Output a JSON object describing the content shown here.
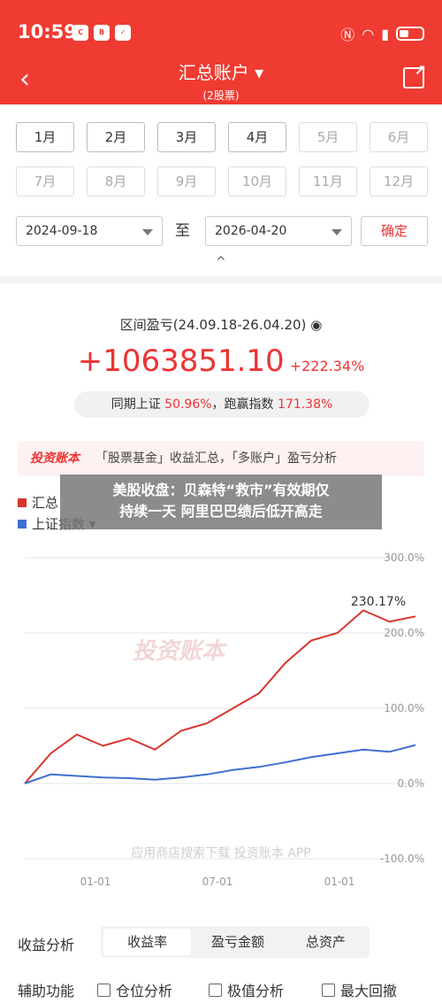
{
  "status": {
    "time": "10:59",
    "icons": [
      "app-icon-c",
      "app-icon-boss",
      "app-icon-red"
    ]
  },
  "header": {
    "title": "汇总账户 ▾",
    "subtitle": "(2股票)"
  },
  "months": [
    "1月",
    "2月",
    "3月",
    "4月",
    "5月",
    "6月",
    "7月",
    "8月",
    "9月",
    "10月",
    "11月",
    "12月"
  ],
  "date_range": {
    "start": "2024-09-18",
    "separator": "至",
    "end": "2026-04-20",
    "confirm": "确定"
  },
  "summary": {
    "range_title": "区间盈亏(24.09.18-26.04.20)",
    "amount": "+1063851.10",
    "percent": "+222.34%",
    "compare_prefix": "同期上证",
    "compare_sh": "50.96%",
    "compare_mid": "，跑赢指数",
    "compare_beat": "171.38%"
  },
  "banner": {
    "logo": "投资账本",
    "text": "「股票基金」收益汇总，「多账户」盈亏分析"
  },
  "legend": {
    "series1": "汇总",
    "series2": "上证指数 ▾"
  },
  "overlay": {
    "line1": "美股收盘：贝森特“救市”有效期仅",
    "line2": "持续一天 阿里巴巴绩后低开高走"
  },
  "colors": {
    "accent": "#f03b32",
    "series1": "#d9342b",
    "series2": "#3d6fd1"
  },
  "chart_data": {
    "type": "line",
    "x": [
      "2024-09",
      "2025-01",
      "2025-07",
      "2026-01",
      "2026-04"
    ],
    "xticks": [
      "01-01",
      "07-01",
      "01-01"
    ],
    "yticks": [
      "300.0%",
      "200.0%",
      "100.0%",
      "0.0%",
      "-100.0%"
    ],
    "ylim": [
      -100,
      300
    ],
    "peak_label": "230.17%",
    "watermark": "投资账本",
    "footer_watermark": "应用商店搜索下载 投资账本 APP",
    "series": [
      {
        "name": "汇总",
        "values": [
          0,
          40,
          65,
          50,
          60,
          45,
          70,
          80,
          100,
          120,
          160,
          190,
          200,
          230,
          215,
          222
        ]
      },
      {
        "name": "上证指数",
        "values": [
          0,
          12,
          10,
          8,
          7,
          5,
          8,
          12,
          18,
          22,
          28,
          35,
          40,
          45,
          42,
          51
        ]
      }
    ]
  },
  "analysis": {
    "label": "收益分析",
    "tabs": [
      "收益率",
      "盈亏金额",
      "总资产"
    ]
  },
  "aux": {
    "label": "辅助功能",
    "opt1": "仓位分析",
    "opt2": "极值分析",
    "opt3": "最大回撤"
  }
}
